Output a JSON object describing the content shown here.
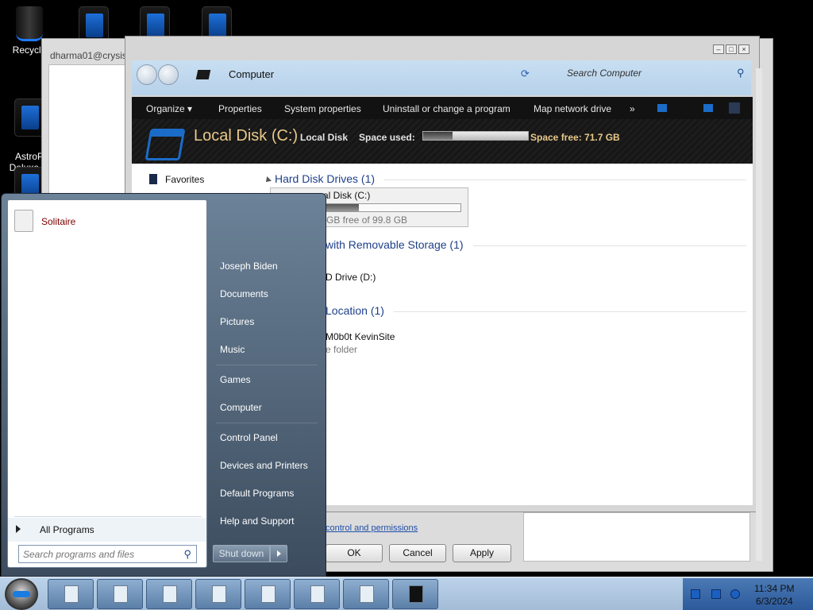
{
  "desktop": {
    "icons": [
      {
        "label": "Recycle"
      },
      {
        "label": "AstroP\nDeluxe.In"
      }
    ]
  },
  "back_window": {
    "title": "dharma01@crysis"
  },
  "explorer": {
    "address": "Computer",
    "search_placeholder": "Search Computer",
    "toolbar": [
      "Organize ▾",
      "Properties",
      "System properties",
      "Uninstall or change a program",
      "Map network drive",
      "»"
    ],
    "details": {
      "title": "Local Disk (C:)",
      "name": "Local Disk",
      "space_used_label": "Space used:",
      "space_free": "Space free: 71.7 GB",
      "used_fraction": 0.28
    },
    "nav": {
      "favorites": "Favorites"
    },
    "groups": [
      {
        "header": "Hard Disk Drives (1)"
      },
      {
        "header": "with Removable Storage (1)"
      },
      {
        "header": "Location (1)"
      }
    ],
    "drive_item": {
      "name": "cal Disk (C:)",
      "free": "7 GB free of 99.8 GB",
      "used_fraction": 0.28
    },
    "removable_item": "D Drive (D:)",
    "network_item": {
      "name": "M0b0t KevinSite",
      "type": "e folder"
    }
  },
  "dialog": {
    "link": "control and permissions",
    "ok": "OK",
    "cancel": "Cancel",
    "apply": "Apply"
  },
  "start_menu": {
    "pinned": [
      {
        "label": "Solitaire"
      }
    ],
    "all_programs": "All Programs",
    "search_placeholder": "Search programs and files",
    "right": [
      "Joseph Biden",
      "Documents",
      "Pictures",
      "Music",
      "Games",
      "Computer",
      "Control Panel",
      "Devices and Printers",
      "Default Programs",
      "Help and Support"
    ],
    "shutdown": "Shut down"
  },
  "taskbar": {
    "time": "11:34 PM",
    "date": "6/3/2024"
  },
  "colors": {
    "accent": "#1e3f8a",
    "start_bg": "#4e6278",
    "taskbar": "#b0c8e0"
  }
}
